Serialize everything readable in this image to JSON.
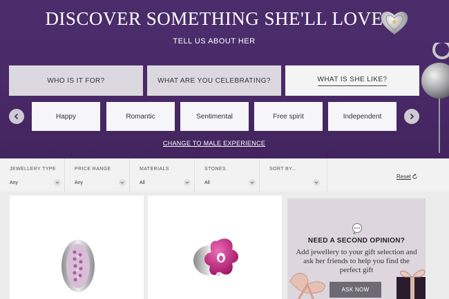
{
  "hero": {
    "title": "DISCOVER SOMETHING SHE'LL LOVE",
    "subtitle": "TELL US ABOUT HER",
    "tabs": [
      {
        "label": "WHO IS IT FOR?"
      },
      {
        "label": "WHAT ARE YOU CELEBRATING?"
      },
      {
        "label": "WHAT IS SHE LIKE?"
      }
    ],
    "moods": [
      "Happy",
      "Romantic",
      "Sentimental",
      "Free spirit",
      "Independent"
    ],
    "switch_link": "CHANGE TO MALE EXPERIENCE",
    "prev_icon": "chevron-left-icon",
    "next_icon": "chevron-right-icon"
  },
  "filters": [
    {
      "label": "JEWELLERY TYPE",
      "value": "Any"
    },
    {
      "label": "PRICE RANGE",
      "value": "Any"
    },
    {
      "label": "MATERIALS",
      "value": "All"
    },
    {
      "label": "STONES",
      "value": "All"
    },
    {
      "label": "SORT BY...",
      "value": ""
    }
  ],
  "reset_label": "Reset",
  "promo": {
    "heading": "NEED A SECOND OPINION?",
    "body": "Add jewellery to your gift selection and ask her friends to help you find the perfect gift",
    "button": "ASK NOW"
  },
  "colors": {
    "hero_bg": "#4a2a68",
    "tab_inactive": "#dcd8e0",
    "tab_active": "#f4f3f5",
    "promo_bg": "#ddd6de",
    "ask_button": "#6d6a73"
  }
}
